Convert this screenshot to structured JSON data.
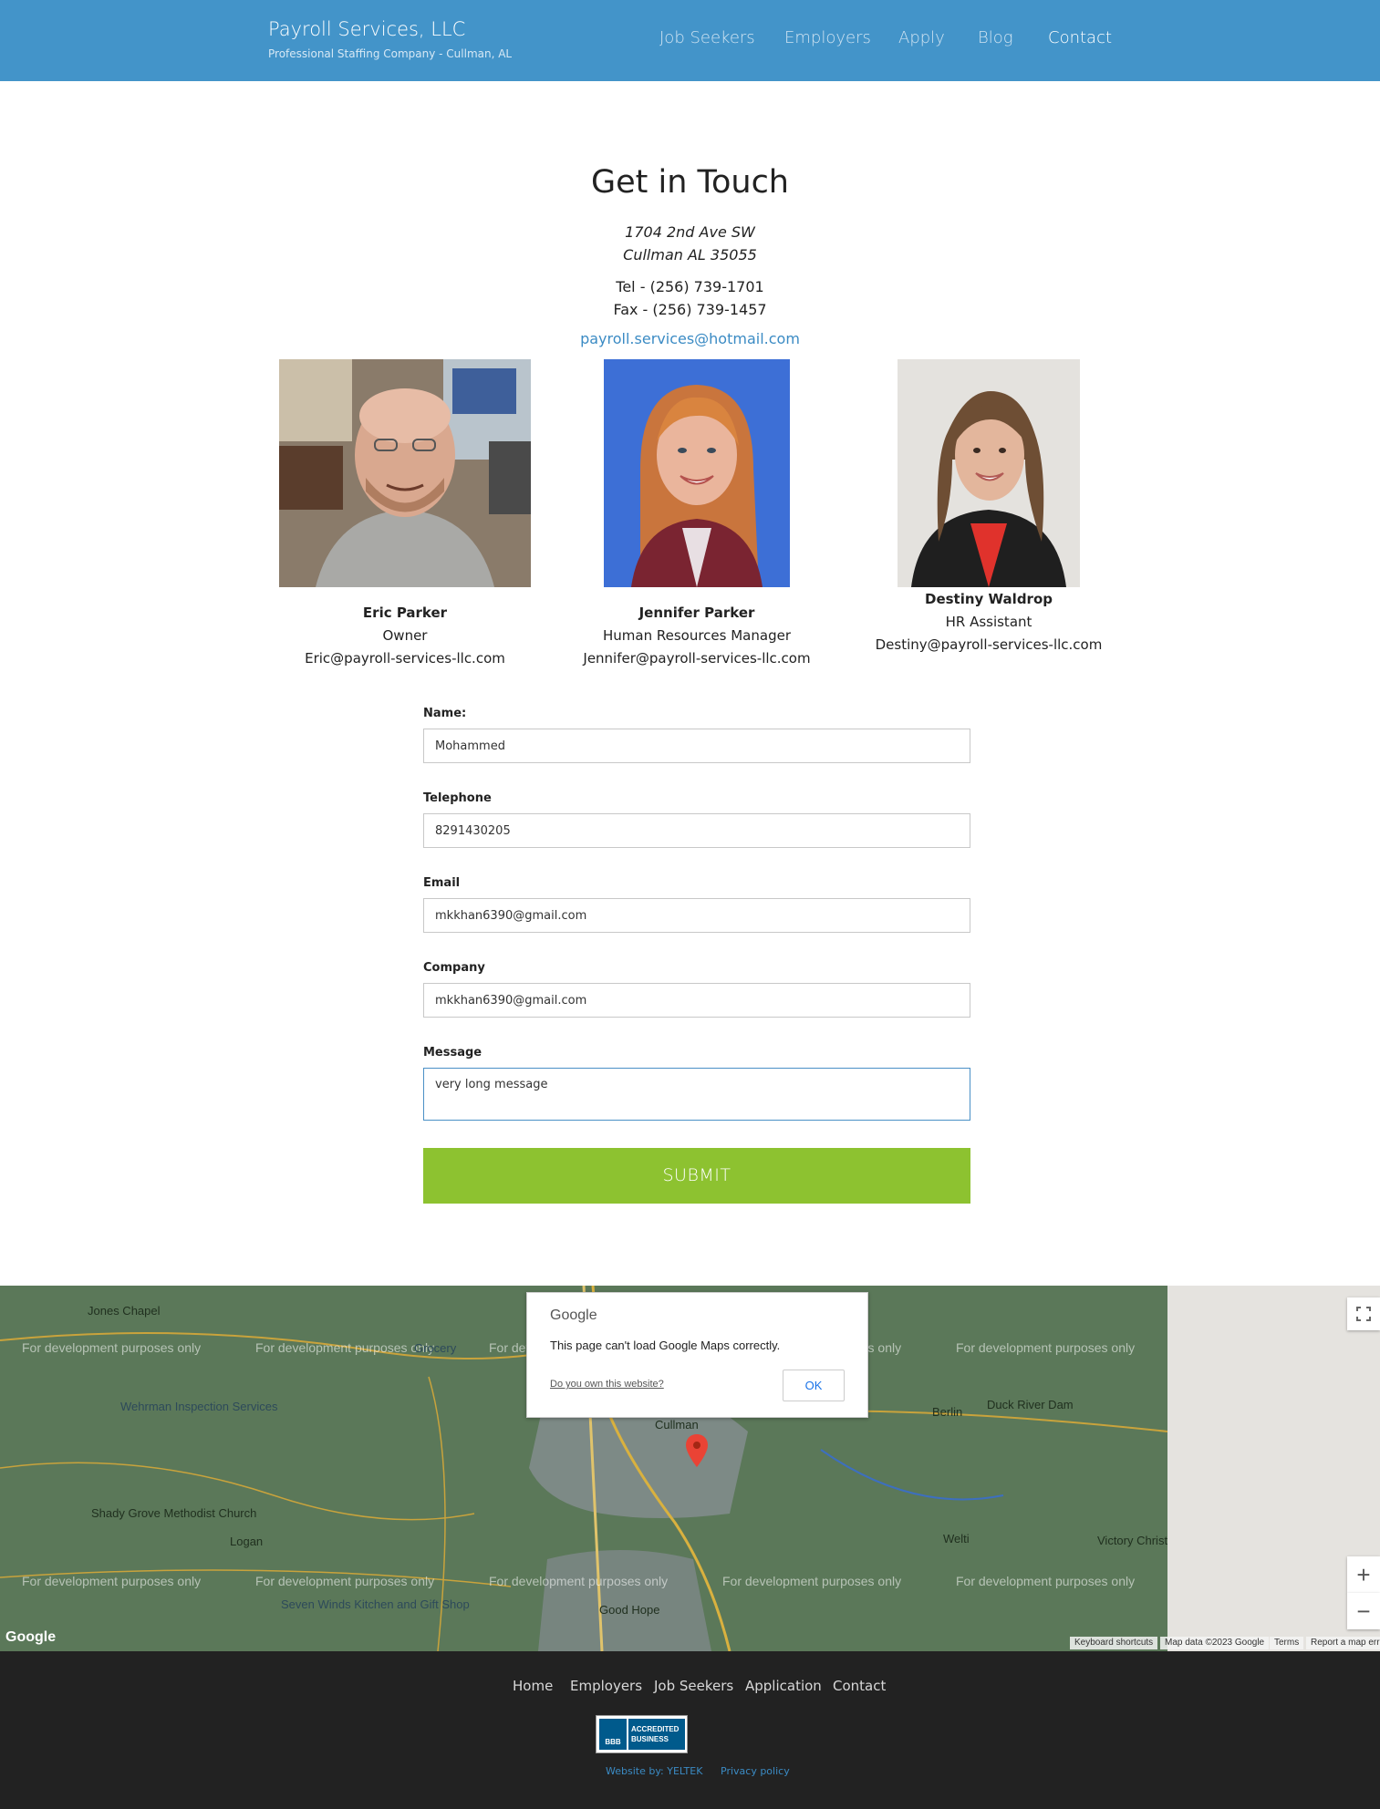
{
  "header": {
    "title": "Payroll Services, LLC",
    "subtitle": "Professional Staffing Company - Cullman, AL",
    "nav": [
      "Job Seekers",
      "Employers",
      "Apply",
      "Blog",
      "Contact"
    ],
    "active_nav": "Contact",
    "color": "#4394c9"
  },
  "contact": {
    "heading": "Get in Touch",
    "address_line1": "1704 2nd Ave SW",
    "address_line2": "Cullman AL 35055",
    "tel": "Tel - (256) 739-1701",
    "fax": "Fax - (256) 739-1457",
    "email": "payroll.services@hotmail.com"
  },
  "staff": [
    {
      "name": "Eric Parker",
      "role": "Owner",
      "email": "Eric@payroll-services-llc.com"
    },
    {
      "name": "Jennifer Parker",
      "role": "Human Resources Manager",
      "email": "Jennifer@payroll-services-llc.com"
    },
    {
      "name": "Destiny Waldrop",
      "role": "HR Assistant",
      "email": "Destiny@payroll-services-llc.com"
    }
  ],
  "form": {
    "name_label": "Name:",
    "name_value": "Mohammed",
    "telephone_label": "Telephone",
    "telephone_value": "8291430205",
    "email_label": "Email",
    "email_value": "mkkhan6390@gmail.com",
    "company_label": "Company",
    "company_value": "mkkhan6390@gmail.com",
    "message_label": "Message",
    "message_value": "very long message",
    "submit_label": "SUBMIT",
    "submit_color": "#8dc230"
  },
  "map": {
    "watermark": "For development purposes only",
    "places": [
      "Jones Chapel",
      "Wehrman Inspection Services",
      "Shady Grove Methodist Church",
      "Logan",
      "Seven Winds Kitchen and Gift Shop",
      "Good Hope",
      "Cullman",
      "Berlin",
      "Duck River Dam",
      "Welti",
      "Victory Christ Fellowship Chu",
      "Grocery"
    ],
    "dialog": {
      "brand": "Google",
      "message": "This page can't load Google Maps correctly.",
      "link": "Do you own this website?",
      "ok": "OK"
    },
    "attribution": [
      "Keyboard shortcuts",
      "Map data ©2023 Google",
      "Terms",
      "Report a map err"
    ],
    "zoom_in": "+",
    "zoom_out": "−",
    "logo": "Google"
  },
  "footer": {
    "links": [
      "Home",
      "Employers",
      "Job Seekers",
      "Application",
      "Contact"
    ],
    "bbb_line1": "ACCREDITED",
    "bbb_line2": "BUSINESS",
    "bbb_mark": "BBB",
    "website_by": "Website by: YELTEK",
    "privacy": "Privacy policy"
  }
}
